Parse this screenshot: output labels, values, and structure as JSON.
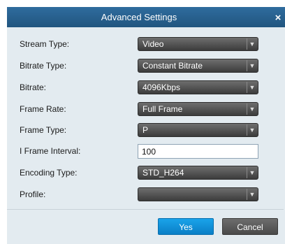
{
  "dialog": {
    "title": "Advanced Settings",
    "close_glyph": "×"
  },
  "fields": [
    {
      "label": "Stream Type:",
      "value": "Video"
    },
    {
      "label": "Bitrate Type:",
      "value": "Constant Bitrate"
    },
    {
      "label": "Bitrate:",
      "value": "4096Kbps"
    },
    {
      "label": "Frame Rate:",
      "value": "Full Frame"
    },
    {
      "label": "Frame Type:",
      "value": "P"
    },
    {
      "label": "I Frame Interval:",
      "value": "100"
    },
    {
      "label": "Encoding Type:",
      "value": "STD_H264"
    },
    {
      "label": "Profile:",
      "value": ""
    }
  ],
  "buttons": {
    "yes": "Yes",
    "cancel": "Cancel"
  },
  "icons": {
    "dropdown": "chevron-down-icon",
    "close": "close-icon"
  },
  "colors": {
    "titlebar": "#21557f",
    "panel": "#e3ebf0",
    "yes_button": "#0a7fc6",
    "cancel_button": "#4a4a4a",
    "select": "#3c3c3c"
  }
}
